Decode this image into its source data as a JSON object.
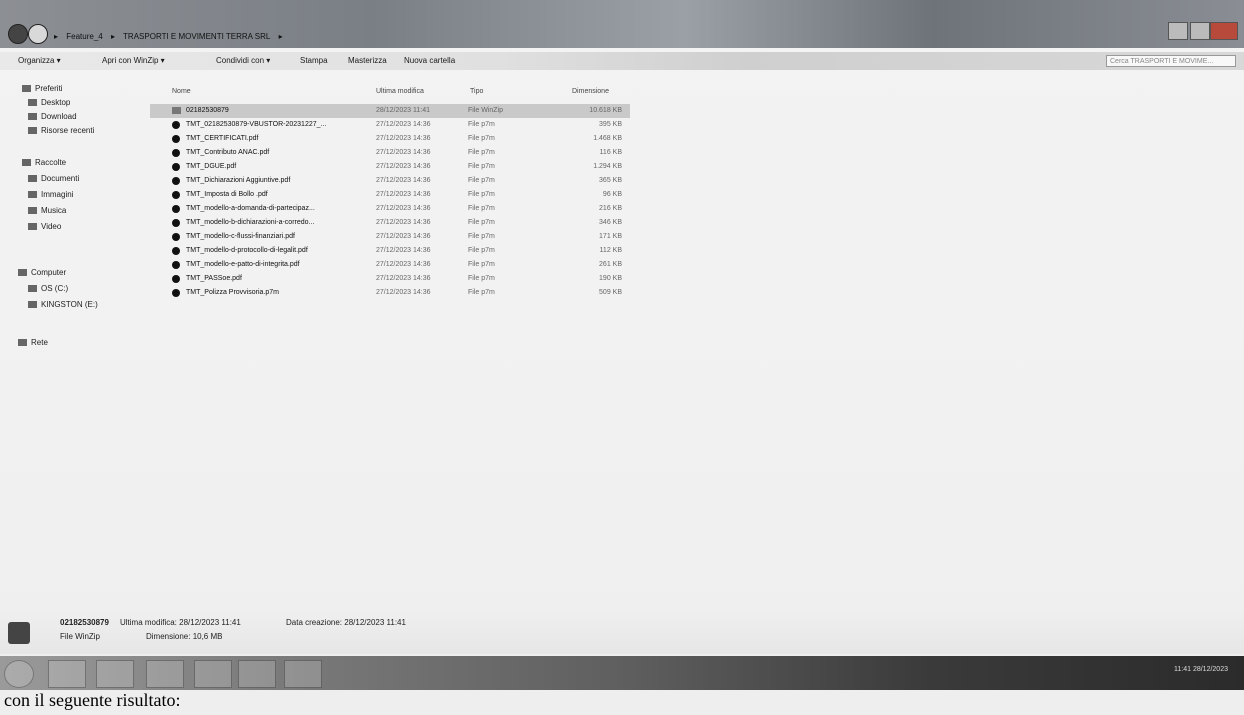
{
  "window": {
    "address_parts": [
      "Feature_4",
      "TRASPORTI E MOVIMENTI TERRA SRL"
    ],
    "search_placeholder": "Cerca TRASPORTI E MOVIME..."
  },
  "toolbar": {
    "organize": "Organizza ▾",
    "open_with": "Apri con WinZip ▾",
    "share_with": "Condividi con ▾",
    "print": "Stampa",
    "burn": "Masterizza",
    "new_folder": "Nuova cartella"
  },
  "navpane": {
    "favorites": "Preferiti",
    "desktop": "Desktop",
    "download": "Download",
    "recent": "Risorse recenti",
    "libraries": "Raccolte",
    "documents": "Documenti",
    "images": "Immagini",
    "music": "Musica",
    "video": "Video",
    "computer": "Computer",
    "os_c": "OS (C:)",
    "kingston": "KINGSTON (E:)",
    "network": "Rete"
  },
  "columns": {
    "name": "Nome",
    "modified": "Ultima modifica",
    "type": "Tipo",
    "size": "Dimensione"
  },
  "files": [
    {
      "name": "02182530879",
      "date": "28/12/2023 11:41",
      "type": "File WinZip",
      "size": "10.618 KB",
      "folder": true
    },
    {
      "name": "TMT_02182530879-VBUSTOR-20231227_...",
      "date": "27/12/2023 14:36",
      "type": "File p7m",
      "size": "395 KB"
    },
    {
      "name": "TMT_CERTIFICATI.pdf",
      "date": "27/12/2023 14:36",
      "type": "File p7m",
      "size": "1.468 KB"
    },
    {
      "name": "TMT_Contributo ANAC.pdf",
      "date": "27/12/2023 14:36",
      "type": "File p7m",
      "size": "116 KB"
    },
    {
      "name": "TMT_DGUE.pdf",
      "date": "27/12/2023 14:36",
      "type": "File p7m",
      "size": "1.294 KB"
    },
    {
      "name": "TMT_Dichiarazioni Aggiuntive.pdf",
      "date": "27/12/2023 14:36",
      "type": "File p7m",
      "size": "365 KB"
    },
    {
      "name": "TMT_Imposta di Bollo .pdf",
      "date": "27/12/2023 14:36",
      "type": "File p7m",
      "size": "96 KB"
    },
    {
      "name": "TMT_modello-a-domanda-di-partecipaz...",
      "date": "27/12/2023 14:36",
      "type": "File p7m",
      "size": "216 KB"
    },
    {
      "name": "TMT_modello-b-dichiarazioni-a-corredo...",
      "date": "27/12/2023 14:36",
      "type": "File p7m",
      "size": "346 KB"
    },
    {
      "name": "TMT_modello-c-flussi-finanziari.pdf",
      "date": "27/12/2023 14:36",
      "type": "File p7m",
      "size": "171 KB"
    },
    {
      "name": "TMT_modello-d-protocollo-di-legalit.pdf",
      "date": "27/12/2023 14:36",
      "type": "File p7m",
      "size": "112 KB"
    },
    {
      "name": "TMT_modello-e-patto-di-integrita.pdf",
      "date": "27/12/2023 14:36",
      "type": "File p7m",
      "size": "261 KB"
    },
    {
      "name": "TMT_PASSoe.pdf",
      "date": "27/12/2023 14:36",
      "type": "File p7m",
      "size": "190 KB"
    },
    {
      "name": "TMT_Polizza Provvisoria.p7m",
      "date": "27/12/2023 14:36",
      "type": "File p7m",
      "size": "509 KB"
    }
  ],
  "details": {
    "name": "02182530879",
    "modified_label": "Ultima modifica: 28/12/2023 11:41",
    "created_label": "Data creazione: 28/12/2023 11:41",
    "type": "File WinZip",
    "size_label": "Dimensione: 10,6 MB"
  },
  "taskbar": {
    "time": "11:41",
    "date": "28/12/2023"
  },
  "caption": "con il seguente risultato:"
}
